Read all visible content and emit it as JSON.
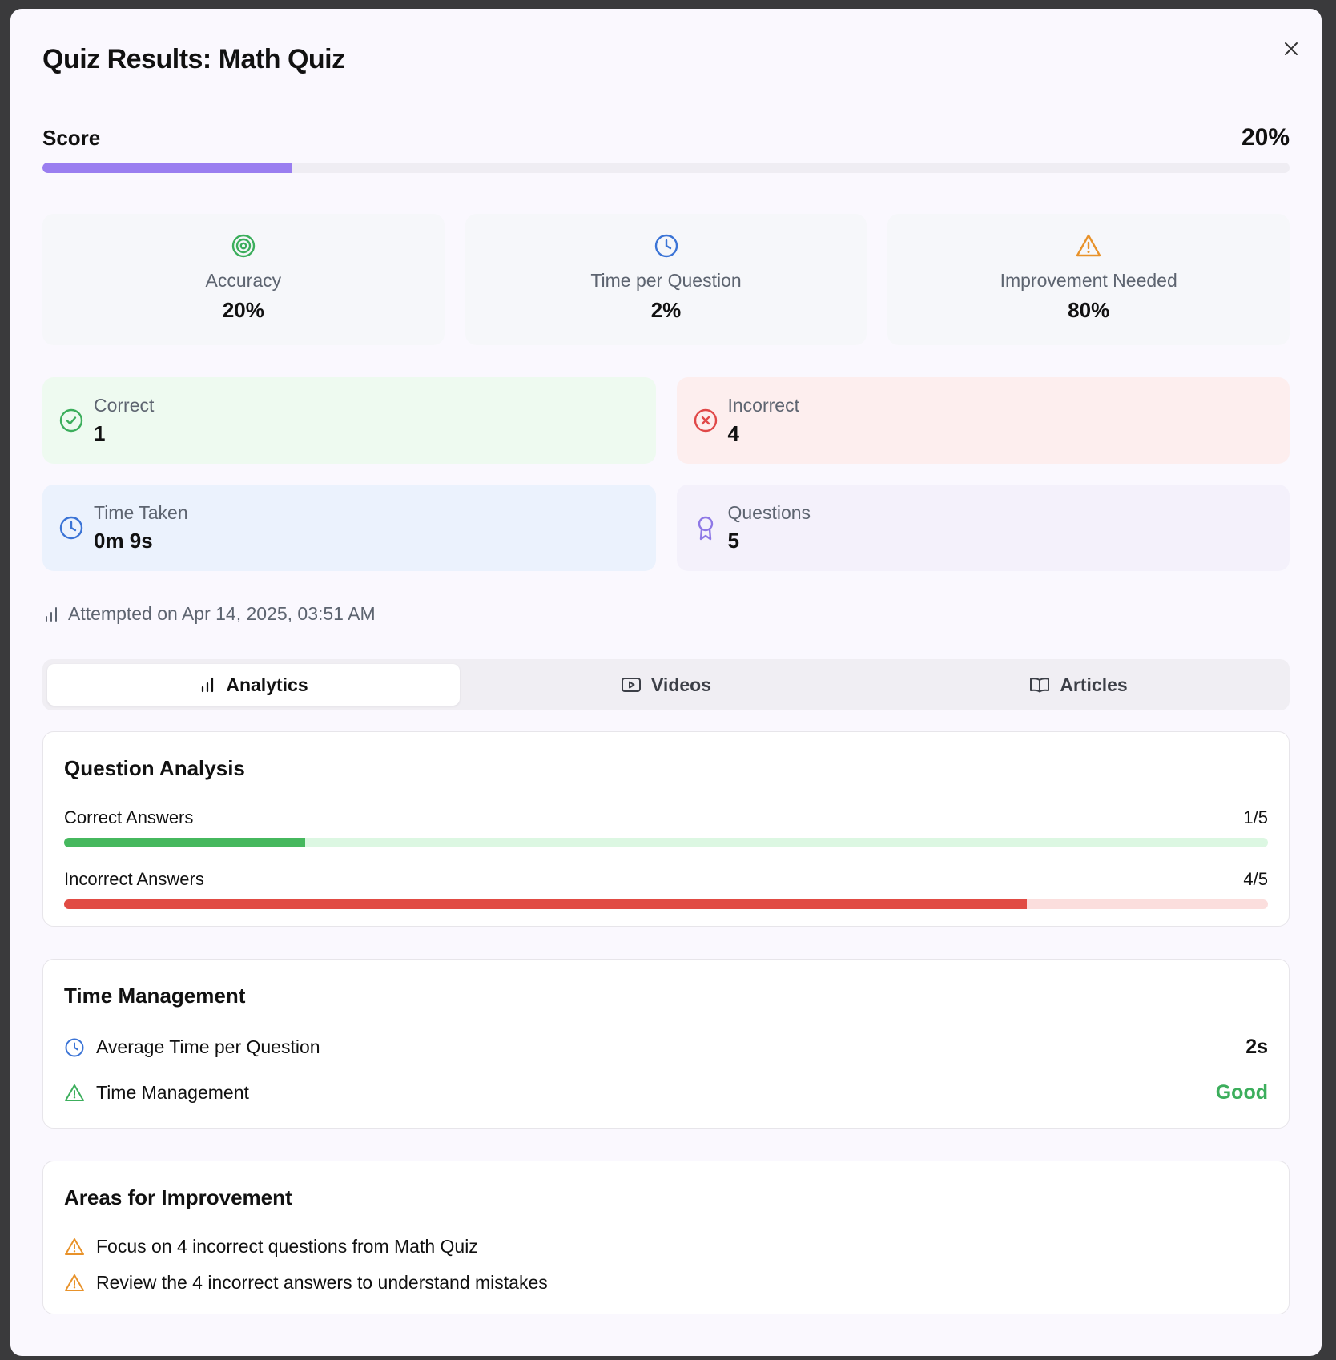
{
  "modal": {
    "title": "Quiz Results: Math Quiz",
    "close_icon": "close-icon"
  },
  "score": {
    "label": "Score",
    "value": "20%",
    "progress": 0.2,
    "color": "#9a7ef0"
  },
  "stats": [
    {
      "icon": "target-icon",
      "label": "Accuracy",
      "value": "20%",
      "color": "#3cae5c"
    },
    {
      "icon": "clock-icon",
      "label": "Time per Question",
      "value": "2%",
      "color": "#3b74d6"
    },
    {
      "icon": "warning-icon",
      "label": "Improvement Needed",
      "value": "80%",
      "color": "#e8922a"
    }
  ],
  "cards": {
    "correct": {
      "label": "Correct",
      "value": "1",
      "icon": "check-circle-icon",
      "color": "#3cae5c"
    },
    "incorrect": {
      "label": "Incorrect",
      "value": "4",
      "icon": "x-circle-icon",
      "color": "#e04848"
    },
    "time_taken": {
      "label": "Time Taken",
      "value": "0m 9s",
      "icon": "clock-icon",
      "color": "#3b74d6"
    },
    "questions": {
      "label": "Questions",
      "value": "5",
      "icon": "award-icon",
      "color": "#8e78e6"
    }
  },
  "attempted": "Attempted on Apr 14, 2025, 03:51 AM",
  "tabs": [
    {
      "label": "Analytics",
      "icon": "bar-chart-icon",
      "active": true
    },
    {
      "label": "Videos",
      "icon": "video-icon",
      "active": false
    },
    {
      "label": "Articles",
      "icon": "book-open-icon",
      "active": false
    }
  ],
  "question_analysis": {
    "title": "Question Analysis",
    "correct": {
      "label": "Correct Answers",
      "value": "1/5",
      "fraction": 0.2,
      "color": "#46b85e",
      "track": "#dcf7e2"
    },
    "incorrect": {
      "label": "Incorrect Answers",
      "value": "4/5",
      "fraction": 0.8,
      "color": "#e14b44",
      "track": "#fbdedd"
    }
  },
  "time_management": {
    "title": "Time Management",
    "avg": {
      "label": "Average Time per Question",
      "value": "2s"
    },
    "status": {
      "label": "Time Management",
      "value": "Good",
      "color": "#3cae5c"
    }
  },
  "improvement": {
    "title": "Areas for Improvement",
    "items": [
      "Focus on 4 incorrect questions from Math Quiz",
      "Review the 4 incorrect answers to understand mistakes"
    ]
  }
}
